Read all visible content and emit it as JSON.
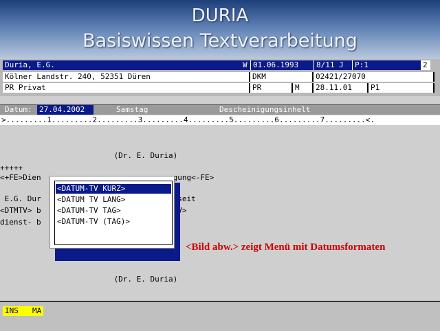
{
  "banner": {
    "title": "DURIA",
    "subtitle": "Basiswissen Textverarbeitung"
  },
  "header": {
    "row1": {
      "name": "Duria, E.G.",
      "flag": "W",
      "date": "01.06.1993",
      "code": "8/11 J",
      "page": "P:1",
      "num": "2"
    },
    "row2": {
      "address": "Kölner Landstr. 240, 52351 Düren",
      "dept": "DKM",
      "phone": "02421/27070"
    },
    "row3": {
      "type": "PR Privat",
      "code1": "PR",
      "code2": "M",
      "date": "28.11.01",
      "page": "P1"
    }
  },
  "datebar": {
    "label": "Datum:",
    "value": "27.04.2002",
    "weekday": "Samstag",
    "title": "Descheinigungsinhelt"
  },
  "ruler": ">.........1.........2.........3.........4.........5.........6.........7.........<.",
  "document": {
    "lines": [
      "                         (Dr. E. Duria)",
      "+++++",
      "<+FE>Dien                             gung<-FE>",
      "",
      " E.G. Dur                              seit",
      "<DTMTV> b                             TV>",
      "dienst- b                             ."
    ],
    "footer_line": "                         (Dr. E. Duria)"
  },
  "popup": {
    "items": [
      "<DATUM-TV KURZ>",
      "<DATUM TV LANG>",
      "<DATUM-TV TAG>",
      "<DATUM-TV (TAG)>"
    ],
    "selected_index": 0
  },
  "caption": "<Bild abw.> zeigt Menü mit Datumsformaten",
  "status": {
    "ins": "INS",
    "ma": "MA"
  },
  "colors": {
    "accent": "#0a1a8a",
    "status_yellow": "#ffff00",
    "caption_red": "#cc0000"
  }
}
